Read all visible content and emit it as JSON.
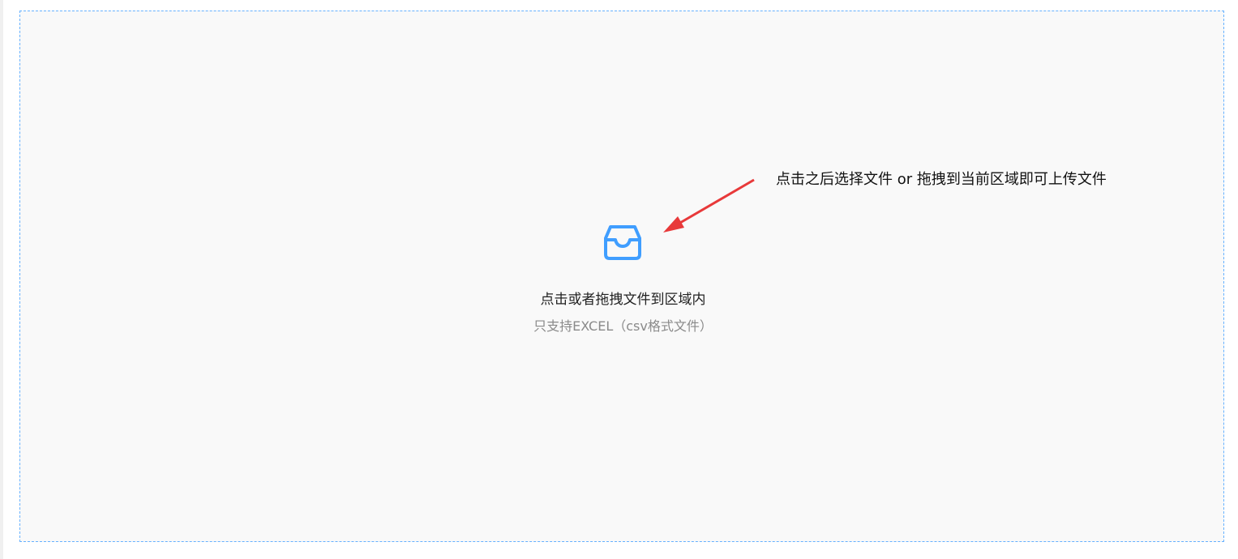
{
  "upload": {
    "primary_text": "点击或者拖拽文件到区域内",
    "secondary_text": "只支持EXCEL（csv格式文件）",
    "icon": "inbox-icon",
    "accent_color": "#409eff"
  },
  "annotation": {
    "text": "点击之后选择文件 or  拖拽到当前区域即可上传文件",
    "arrow_color": "#e8393a"
  }
}
